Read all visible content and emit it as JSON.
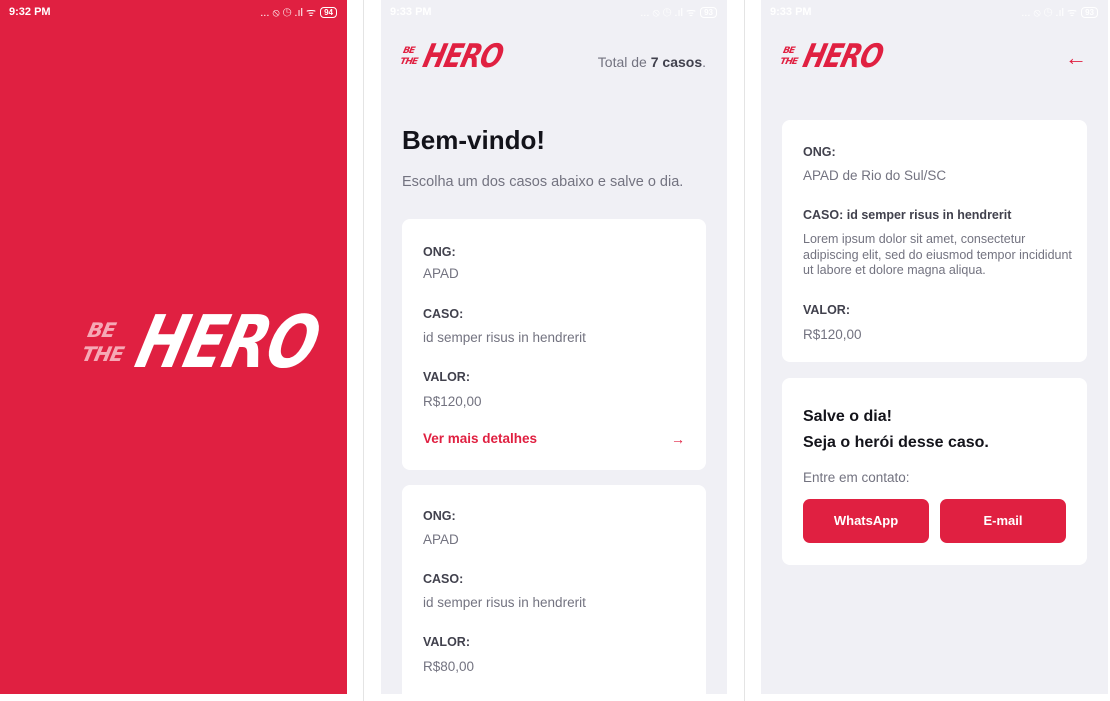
{
  "brand": {
    "logo_be": "BE",
    "logo_the": "THE",
    "logo_hero": "HERO"
  },
  "colors": {
    "primary": "#e02041",
    "background": "#f0f0f5",
    "card": "#ffffff"
  },
  "splash": {
    "status": {
      "time": "9:32 PM",
      "icons": "... ⦸ ◷ .ıl ᯤ",
      "battery": "94"
    }
  },
  "list_screen": {
    "status": {
      "time": "9:33 PM",
      "icons": "... ⦸ ◷ .ıl ᯤ",
      "battery": "93"
    },
    "total_prefix": "Total de ",
    "total_count": "7 casos",
    "total_suffix": ".",
    "title": "Bem-vindo!",
    "subtitle": "Escolha um dos casos abaixo e salve o dia.",
    "incidents": [
      {
        "ong_label": "ONG:",
        "ong": "APAD",
        "case_label": "CASO:",
        "case": "id semper risus in hendrerit",
        "value_label": "VALOR:",
        "value": "R$120,00",
        "details": "Ver mais detalhes"
      },
      {
        "ong_label": "ONG:",
        "ong": "APAD",
        "case_label": "CASO:",
        "case": "id semper risus in hendrerit",
        "value_label": "VALOR:",
        "value": "R$80,00"
      }
    ],
    "details_arrow_icon": "arrow-right-icon"
  },
  "detail_screen": {
    "status": {
      "time": "9:33 PM",
      "icons": "... ⦸ ◷ .ıl ᯤ",
      "battery": "93"
    },
    "back_icon": "arrow-left-icon",
    "ong_label": "ONG:",
    "ong": "APAD de Rio do Sul/SC",
    "case_label": "CASO: id semper risus in hendrerit",
    "description": "Lorem ipsum dolor sit amet, consectetur adipiscing elit, sed do eiusmod tempor incididunt ut labore et dolore magna aliqua.",
    "value_label": "VALOR:",
    "value": "R$120,00",
    "hero_line1": "Salve o dia!",
    "hero_line2": "Seja o herói desse caso.",
    "contact_label": "Entre em contato:",
    "whatsapp": "WhatsApp",
    "email": "E-mail"
  }
}
